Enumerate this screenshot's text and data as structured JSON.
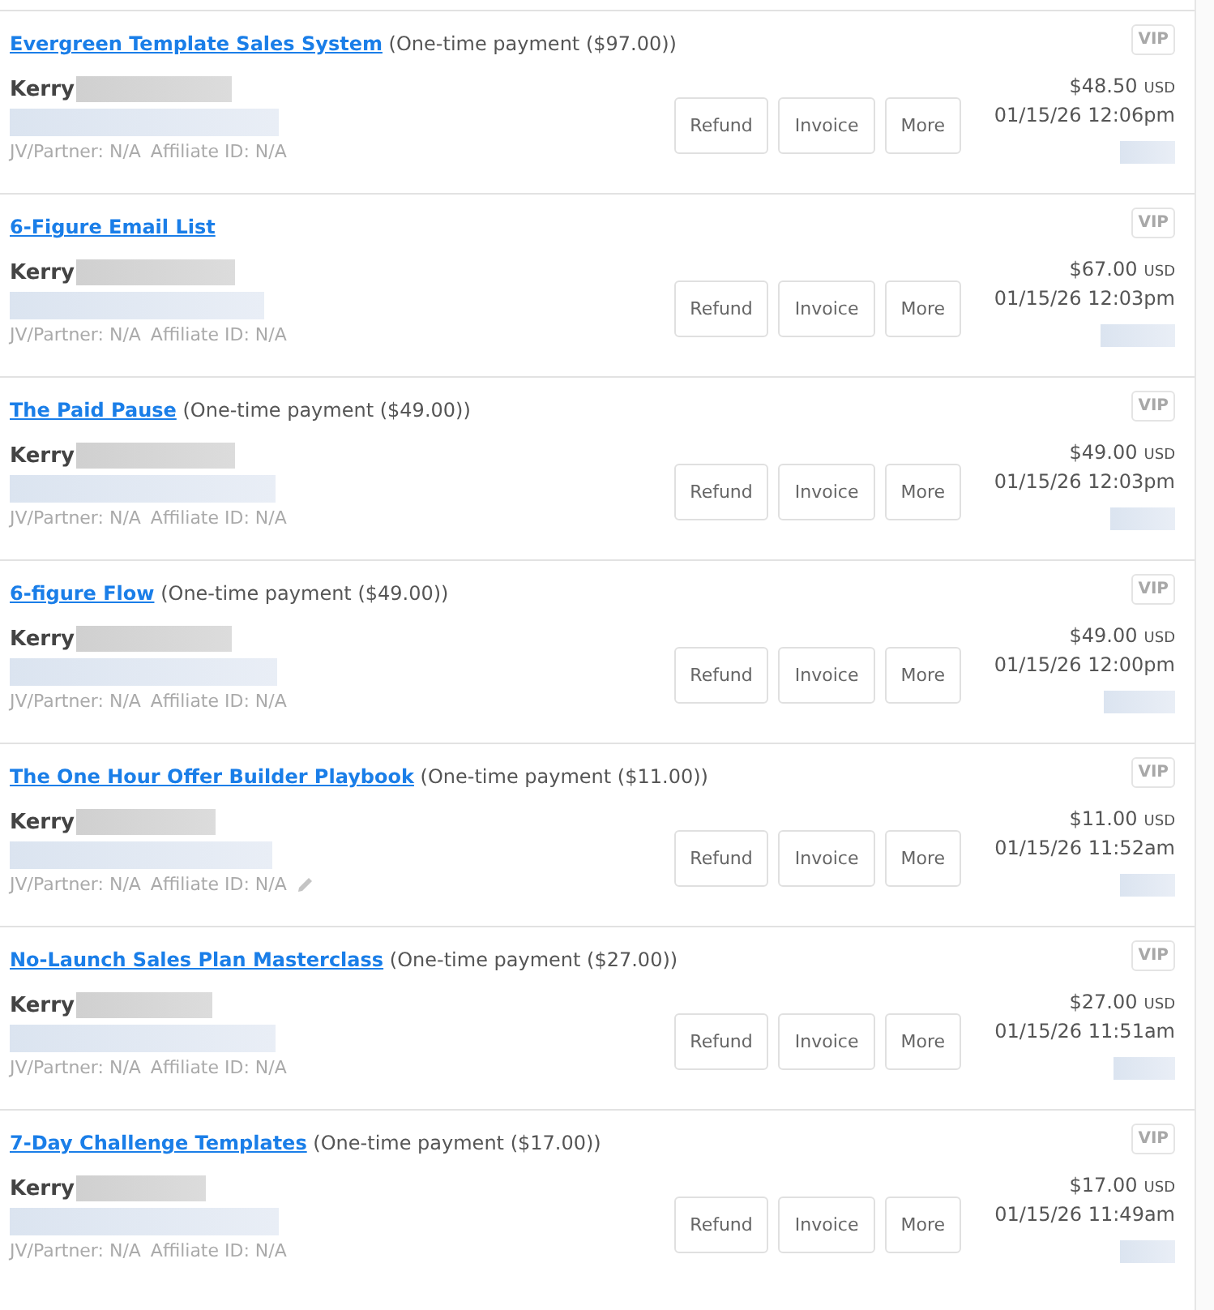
{
  "orders": [
    {
      "product": "Evergreen Template Sales System",
      "payment": "(One-time payment ($97.00))",
      "customer": "Kerry",
      "jv": "JV/Partner: N/A",
      "affiliate": "Affiliate ID: N/A",
      "edit_icon": false,
      "badge": "VIP",
      "buttons": [
        "Refund",
        "Invoice",
        "More"
      ],
      "amount": "$48.50",
      "currency": "USD",
      "date": "01/15/26 12:06pm"
    },
    {
      "product": "6-Figure Email List",
      "customer": "Kerry",
      "jv": "JV/Partner: N/A",
      "affiliate": "Affiliate ID: N/A",
      "edit_icon": false,
      "badge": "VIP",
      "buttons": [
        "Refund",
        "Invoice",
        "More"
      ],
      "amount": "$67.00",
      "currency": "USD",
      "date": "01/15/26 12:03pm"
    },
    {
      "product": "The Paid Pause",
      "payment": "(One-time payment ($49.00))",
      "customer": "Kerry",
      "jv": "JV/Partner: N/A",
      "affiliate": "Affiliate ID: N/A",
      "edit_icon": false,
      "badge": "VIP",
      "buttons": [
        "Refund",
        "Invoice",
        "More"
      ],
      "amount": "$49.00",
      "currency": "USD",
      "date": "01/15/26 12:03pm"
    },
    {
      "product": "6-figure Flow",
      "payment": "(One-time payment ($49.00))",
      "customer": "Kerry",
      "jv": "JV/Partner: N/A",
      "affiliate": "Affiliate ID: N/A",
      "edit_icon": false,
      "badge": "VIP",
      "buttons": [
        "Refund",
        "Invoice",
        "More"
      ],
      "amount": "$49.00",
      "currency": "USD",
      "date": "01/15/26 12:00pm"
    },
    {
      "product": "The One Hour Offer Builder Playbook",
      "payment": "(One-time payment ($11.00))",
      "customer": "Kerry",
      "jv": "JV/Partner: N/A",
      "affiliate": "Affiliate ID: N/A",
      "edit_icon": true,
      "badge": "VIP",
      "buttons": [
        "Refund",
        "Invoice",
        "More"
      ],
      "amount": "$11.00",
      "currency": "USD",
      "date": "01/15/26 11:52am"
    },
    {
      "product": "No-Launch Sales Plan Masterclass",
      "payment": "(One-time payment ($27.00))",
      "customer": "Kerry",
      "jv": "JV/Partner: N/A",
      "affiliate": "Affiliate ID: N/A",
      "edit_icon": false,
      "badge": "VIP",
      "buttons": [
        "Refund",
        "Invoice",
        "More"
      ],
      "amount": "$27.00",
      "currency": "USD",
      "date": "01/15/26 11:51am"
    },
    {
      "product": "7-Day Challenge Templates",
      "payment": "(One-time payment ($17.00))",
      "customer": "Kerry",
      "jv": "JV/Partner: N/A",
      "affiliate": "Affiliate ID: N/A",
      "edit_icon": false,
      "badge": "VIP",
      "buttons": [
        "Refund",
        "Invoice",
        "More"
      ],
      "amount": "$17.00",
      "currency": "USD",
      "date": "01/15/26 11:49am"
    }
  ]
}
